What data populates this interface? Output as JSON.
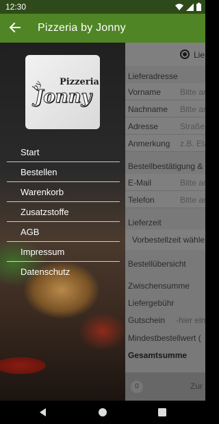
{
  "status": {
    "time": "12:30",
    "icons": [
      "wifi-icon",
      "signal-icon",
      "battery-icon"
    ]
  },
  "appbar": {
    "title": "Pizzeria by Jonny",
    "back_icon": "arrow-left-icon"
  },
  "logo": {
    "line1": "Pizzeria",
    "line2": "by",
    "line3": "Jonny"
  },
  "drawer": {
    "items": [
      {
        "label": "Start"
      },
      {
        "label": "Bestellen"
      },
      {
        "label": "Warenkorb"
      },
      {
        "label": "Zusatzstoffe"
      },
      {
        "label": "AGB"
      },
      {
        "label": "Impressum"
      },
      {
        "label": "Datenschutz"
      }
    ]
  },
  "form": {
    "radio_label": "Lie",
    "address_header": "Lieferadresse",
    "fields": [
      {
        "label": "Vorname",
        "placeholder": "Bitte ar"
      },
      {
        "label": "Nachname",
        "placeholder": "Bitte ar"
      },
      {
        "label": "Adresse",
        "placeholder": "Straße"
      },
      {
        "label": "Anmerkung",
        "placeholder": "z.B. Eta"
      }
    ],
    "confirm_header": "Bestellbestätigung &",
    "contact_fields": [
      {
        "label": "E-Mail",
        "placeholder": "Bitte ar"
      },
      {
        "label": "Telefon",
        "placeholder": "Bitte ar"
      }
    ],
    "delivery_header": "Lieferzeit",
    "delivery_select": "Vorbestellzeit wähle",
    "overview_header": "Bestellübersicht",
    "subtotal": "Zwischensumme",
    "fee": "Liefergebühr",
    "voucher": "Gutschein",
    "voucher_placeholder": "-hier ein",
    "minimum": "Mindestbestellwert (",
    "total": "Gesamtsumme",
    "cart_count": "0",
    "bottom_button": "Zur"
  },
  "colors": {
    "primary": "#4f8524",
    "statusbar": "#2f4a1a"
  }
}
